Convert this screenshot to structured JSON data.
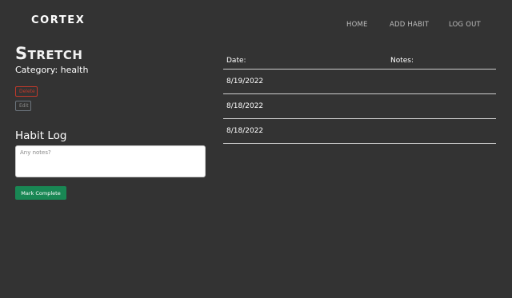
{
  "nav": {
    "brand": "CORTEX",
    "links": [
      "HOME",
      "ADD HABIT",
      "LOG OUT"
    ]
  },
  "habit": {
    "title": "Stretch",
    "category": "Category: health",
    "delete_label": "Delete",
    "edit_label": "Edit"
  },
  "log_form": {
    "title": "Habit Log",
    "notes_placeholder": "Any notes?",
    "submit_label": "Mark Complete"
  },
  "log_table": {
    "headers": [
      "Date:",
      "Notes:"
    ],
    "rows": [
      {
        "date": "8/19/2022",
        "notes": ""
      },
      {
        "date": "8/18/2022",
        "notes": ""
      },
      {
        "date": "8/18/2022",
        "notes": ""
      }
    ]
  },
  "colors": {
    "background": "#333333",
    "complete_button": "#198754",
    "delete_border": "#c0392b"
  }
}
